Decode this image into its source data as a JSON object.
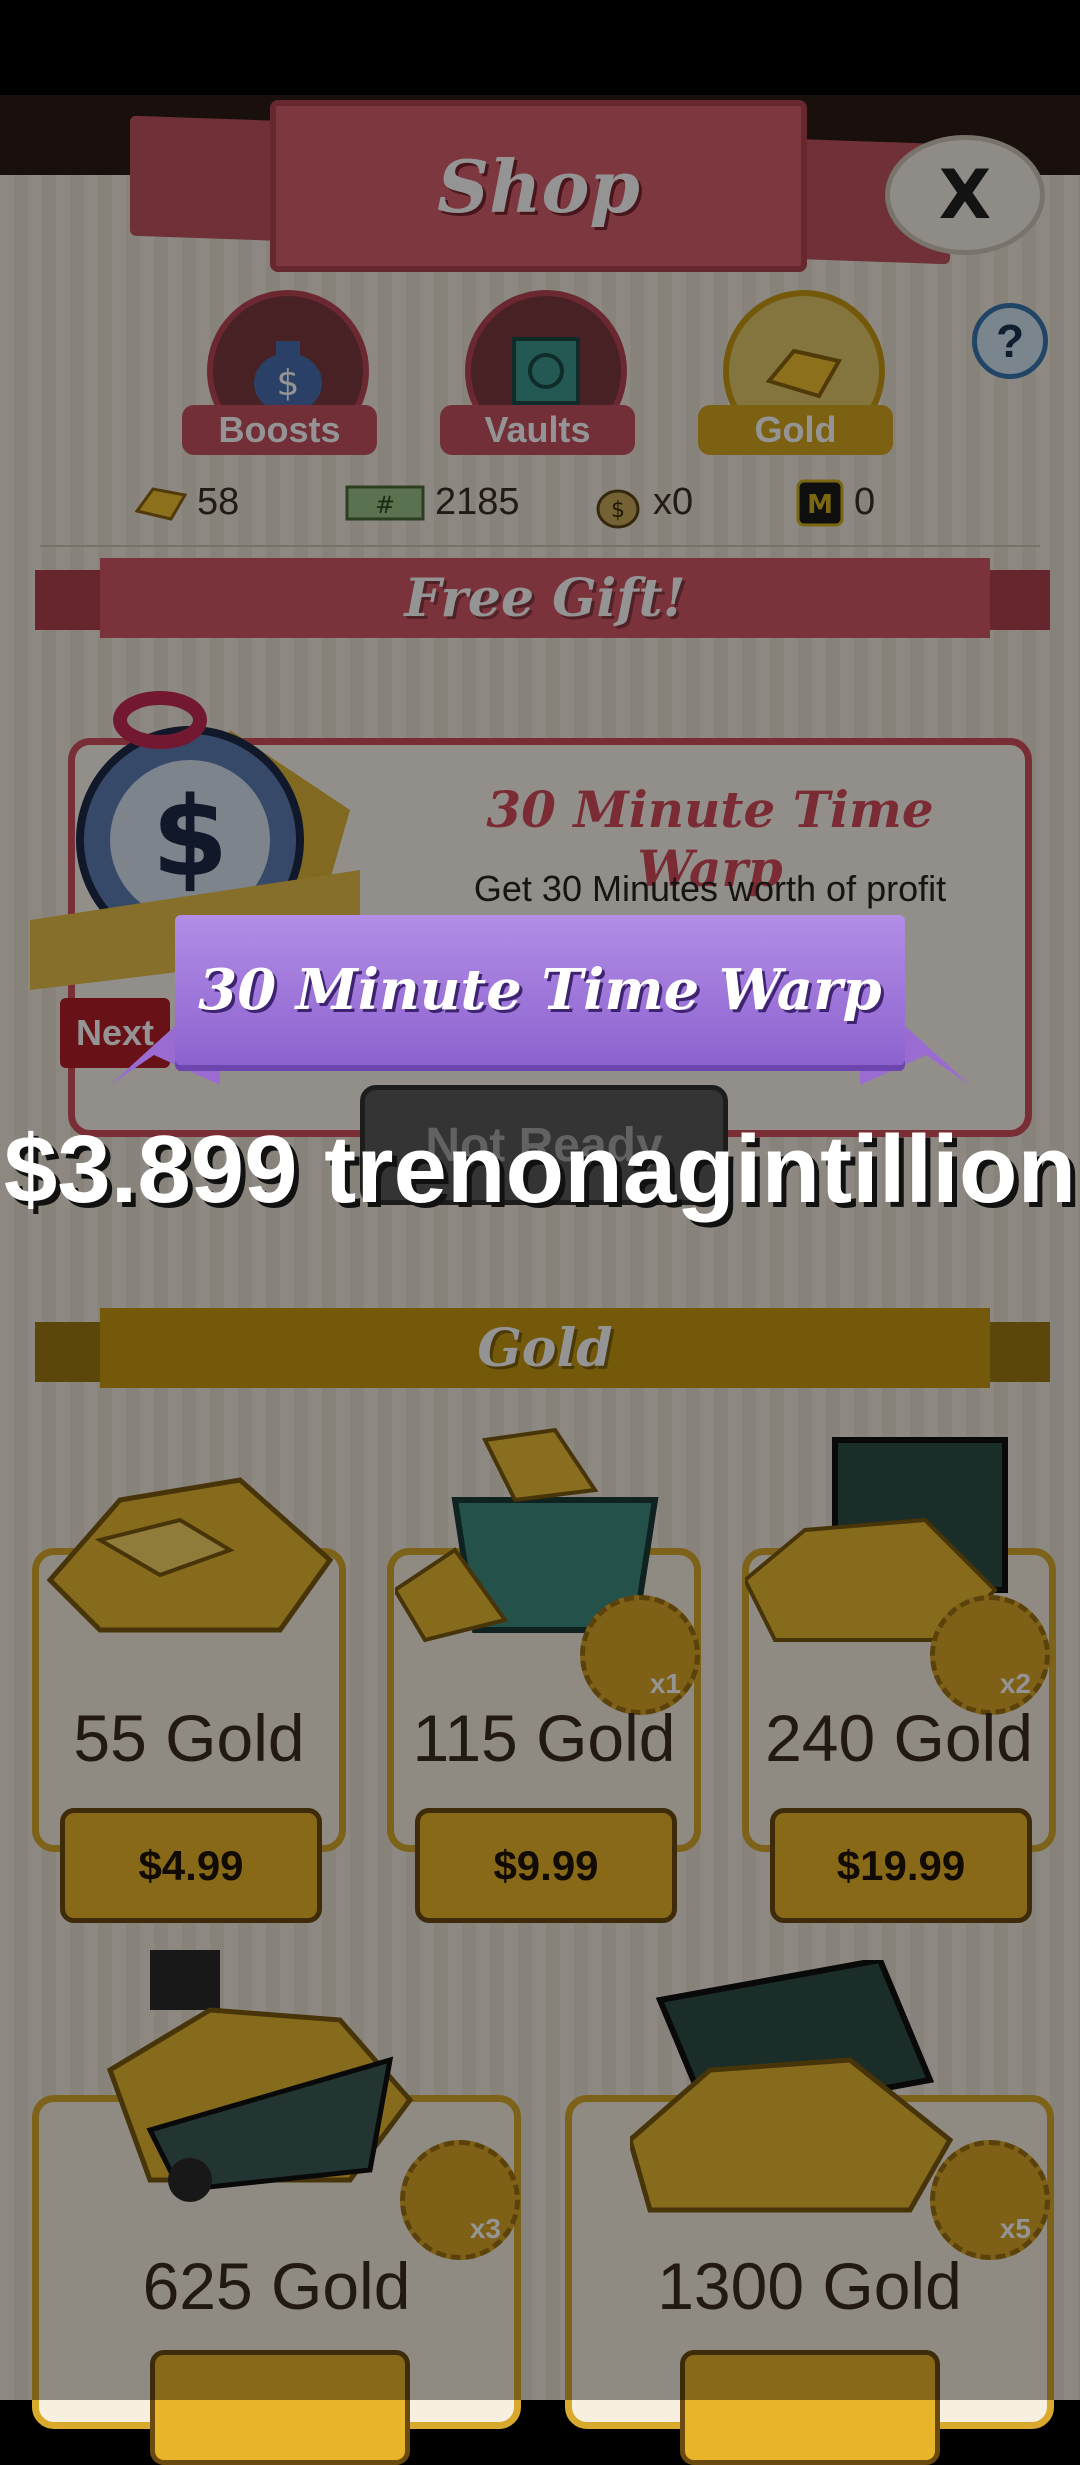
{
  "shop": {
    "title": "Shop",
    "close_label": "X",
    "help_label": "?"
  },
  "tabs": [
    {
      "label": "Boosts",
      "icon": "money-bag-icon"
    },
    {
      "label": "Vaults",
      "icon": "vault-icon"
    },
    {
      "label": "Gold",
      "icon": "gold-bar-icon"
    }
  ],
  "currencies": [
    {
      "icon": "gold-bar-icon",
      "value": "58"
    },
    {
      "icon": "cash-note-icon",
      "value": "2185"
    },
    {
      "icon": "money-bag-icon",
      "value": "x0"
    },
    {
      "icon": "m-badge-icon",
      "value": "0"
    }
  ],
  "free_gift": {
    "section_title": "Free Gift!",
    "item_title": "30 Minute Time Warp",
    "description": "Get 30 Minutes worth of profit",
    "next_label": "Next",
    "button_label": "Not Ready"
  },
  "gold_section": {
    "title": "Gold",
    "items": [
      {
        "name": "55 Gold",
        "price": "$4.99",
        "badge": ""
      },
      {
        "name": "115 Gold",
        "price": "$9.99",
        "badge": "x1"
      },
      {
        "name": "240 Gold",
        "price": "$19.99",
        "badge": "x2"
      },
      {
        "name": "625 Gold",
        "price": "",
        "badge": "x3"
      },
      {
        "name": "1300 Gold",
        "price": "",
        "badge": "x5"
      }
    ]
  },
  "popup": {
    "title": "30 Minute Time Warp",
    "amount": "$3.899 trenonagintillion"
  },
  "colors": {
    "shop_red": "#d85f6c",
    "gold": "#e8b52a",
    "popup_purple": "#9a6bd1"
  }
}
